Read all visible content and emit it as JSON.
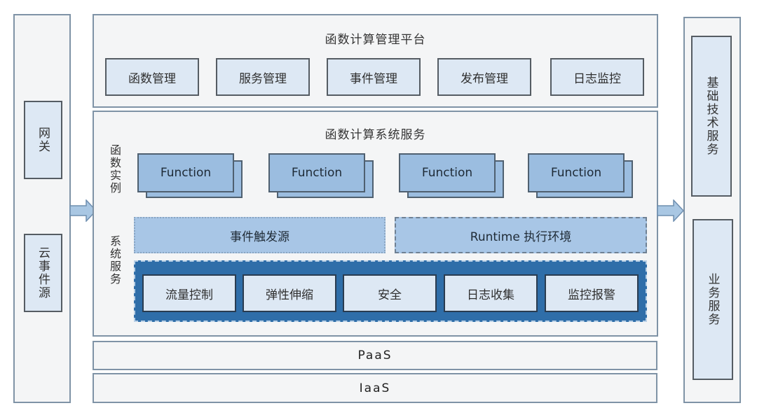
{
  "left_column": {
    "items": [
      {
        "label": "网关"
      },
      {
        "label": "云事件源"
      }
    ]
  },
  "management_platform": {
    "title": "函数计算管理平台",
    "items": [
      {
        "label": "函数管理"
      },
      {
        "label": "服务管理"
      },
      {
        "label": "事件管理"
      },
      {
        "label": "发布管理"
      },
      {
        "label": "日志监控"
      }
    ]
  },
  "system_service": {
    "title": "函数计算系统服务",
    "instances_label": "函数实例",
    "services_label": "系统服务",
    "functions": [
      {
        "label": "Function"
      },
      {
        "label": "Function"
      },
      {
        "label": "Function"
      },
      {
        "label": "Function"
      }
    ],
    "event_trigger": "事件触发源",
    "runtime": "Runtime 执行环境",
    "system_items": [
      {
        "label": "流量控制"
      },
      {
        "label": "弹性伸缩"
      },
      {
        "label": "安全"
      },
      {
        "label": "日志收集"
      },
      {
        "label": "监控报警"
      }
    ]
  },
  "layers": {
    "paas": "PaaS",
    "iaas": "IaaS"
  },
  "right_column": {
    "items": [
      {
        "label": "基础技术服务"
      },
      {
        "label": "业务服务"
      }
    ]
  },
  "colors": {
    "panel_bg": "#f4f5f6",
    "panel_border": "#7f93a6",
    "light_box": "#dde8f4",
    "function_box": "#9bbde0",
    "system_box": "#2f6ea9",
    "arrow": "#a9c7e3"
  }
}
